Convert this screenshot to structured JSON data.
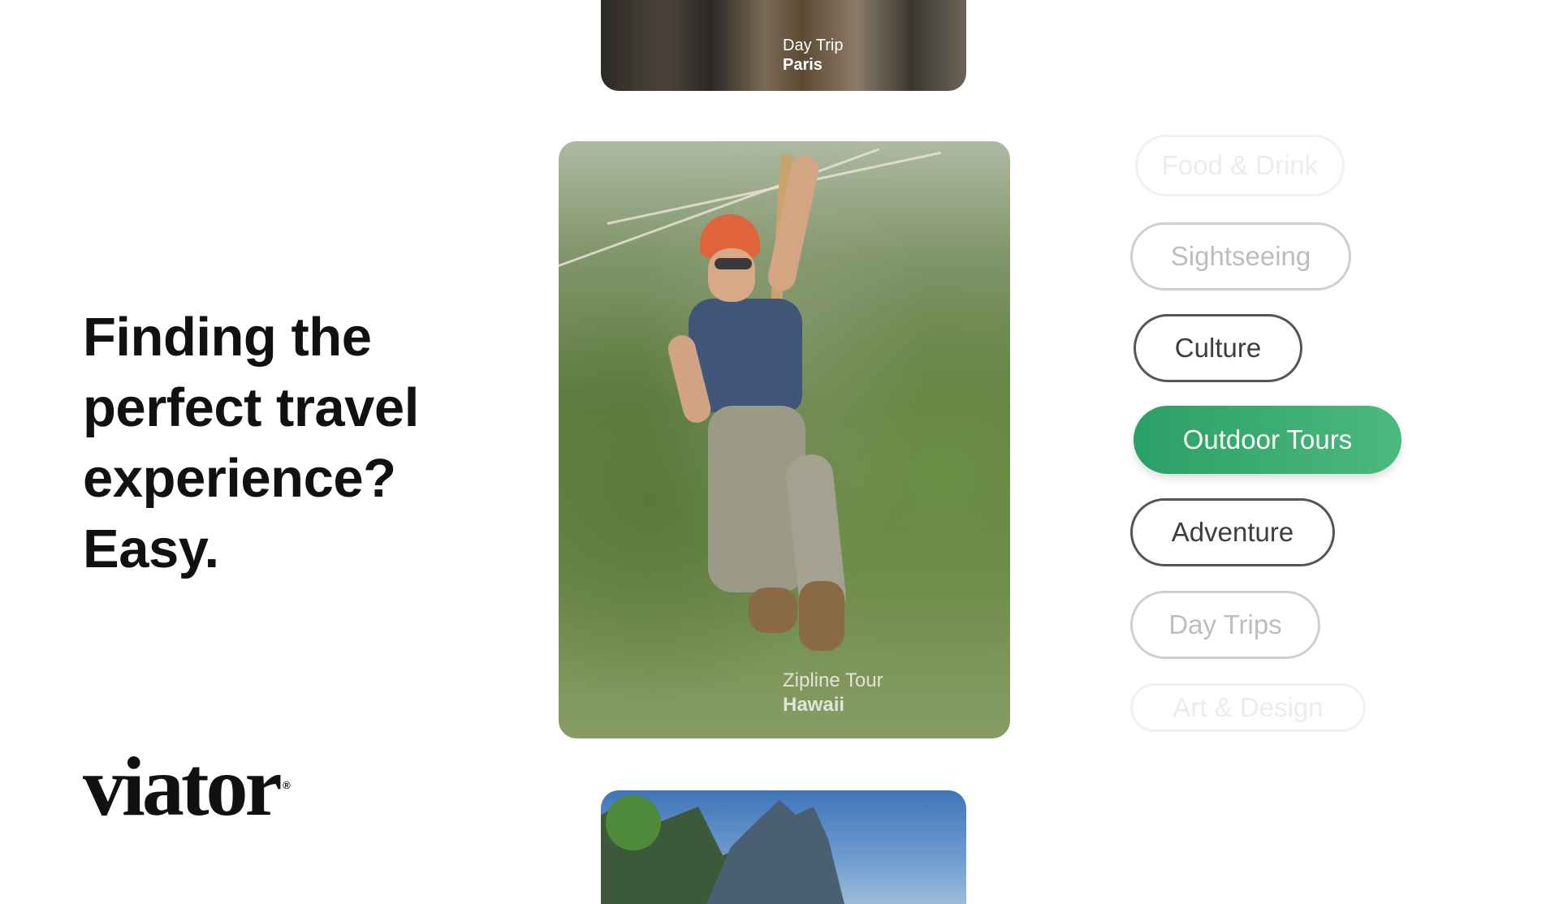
{
  "headline": {
    "line1": "Finding the",
    "line2": "perfect travel",
    "line3": "experience?",
    "line4": "Easy."
  },
  "logo": {
    "text": "viator",
    "mark": "®"
  },
  "cards": [
    {
      "type": "Day Trip",
      "city": "Paris"
    },
    {
      "type": "Zipline Tour",
      "city": "Hawaii"
    },
    {
      "type": "",
      "city": ""
    }
  ],
  "categories": [
    {
      "label": "Food & Drink",
      "state": "ghost"
    },
    {
      "label": "Sightseeing",
      "state": "faded"
    },
    {
      "label": "Culture",
      "state": "normal"
    },
    {
      "label": "Outdoor Tours",
      "state": "active"
    },
    {
      "label": "Adventure",
      "state": "normal"
    },
    {
      "label": "Day Trips",
      "state": "faded"
    },
    {
      "label": "Art & Design",
      "state": "ghost"
    }
  ],
  "colors": {
    "accent": "#2aa066",
    "text": "#111111",
    "background": "#ffffff"
  }
}
